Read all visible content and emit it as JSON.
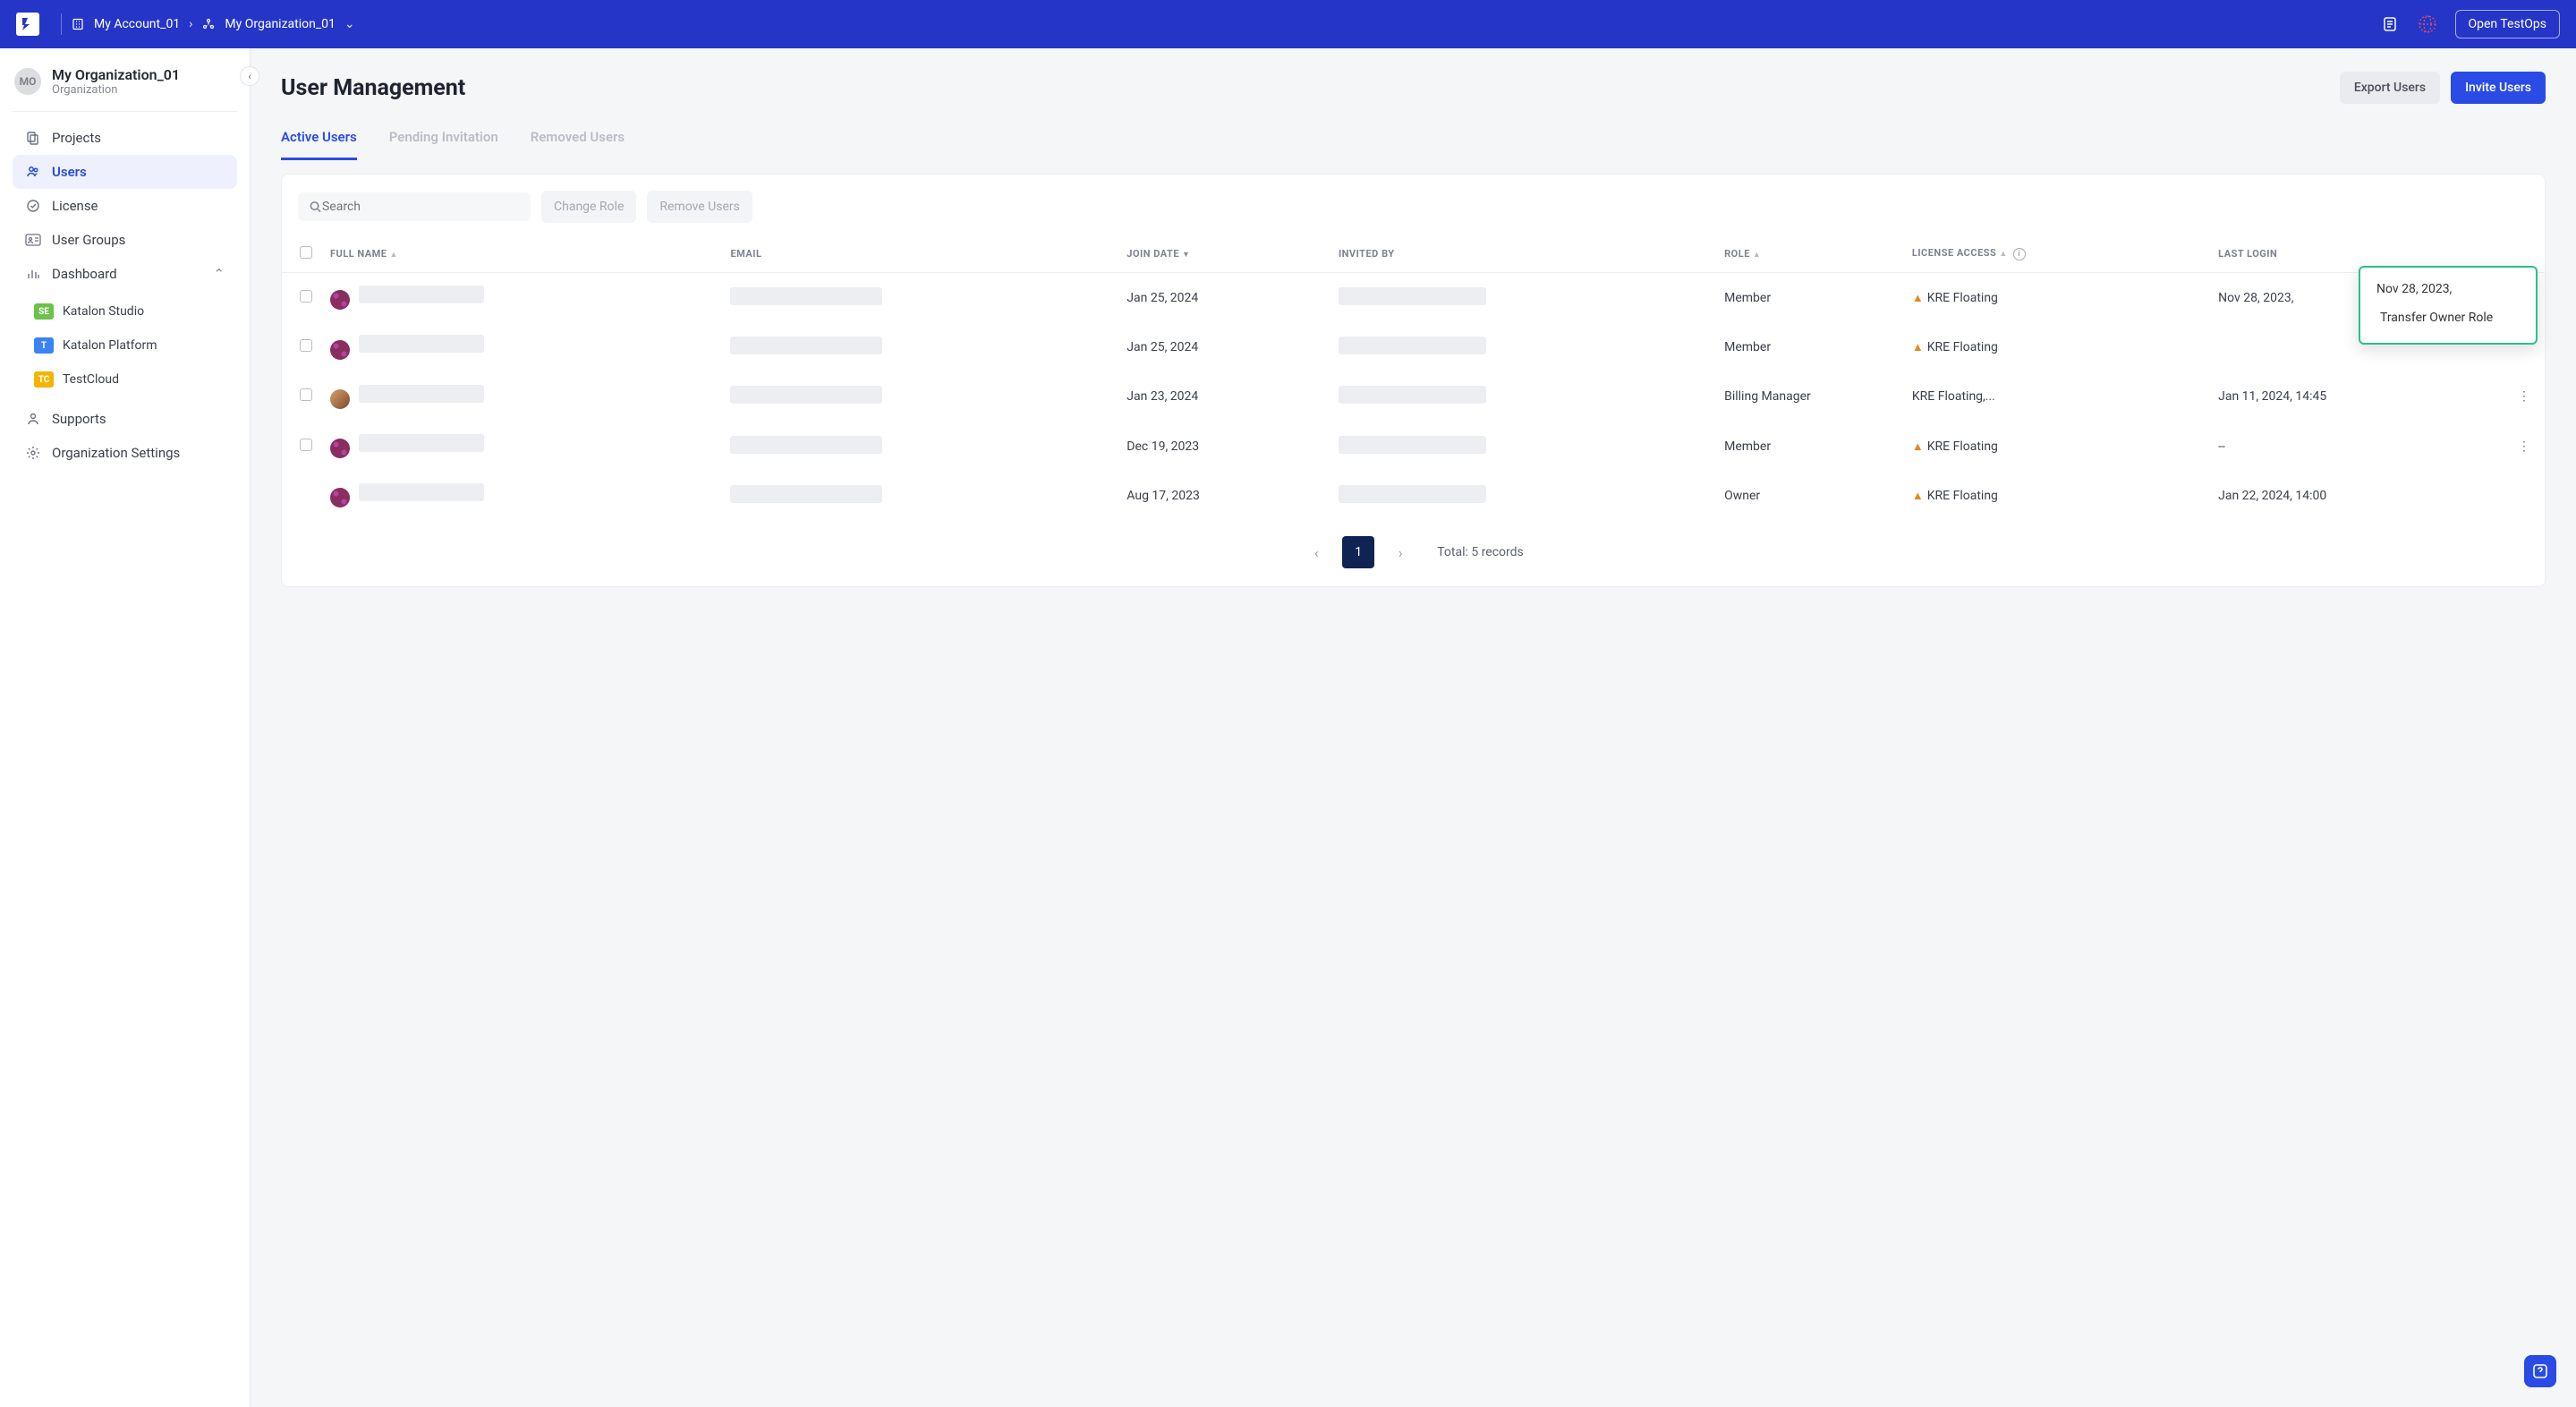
{
  "header": {
    "account_label": "My Account_01",
    "org_label": "My Organization_01",
    "open_testops": "Open TestOps"
  },
  "sidebar": {
    "org_initials": "MO",
    "org_name": "My Organization_01",
    "org_type": "Organization",
    "items": [
      {
        "label": "Projects",
        "icon": "projects-icon"
      },
      {
        "label": "Users",
        "icon": "users-icon",
        "active": true
      },
      {
        "label": "License",
        "icon": "license-icon"
      },
      {
        "label": "User Groups",
        "icon": "user-groups-icon"
      },
      {
        "label": "Dashboard",
        "icon": "dashboard-icon",
        "expandable": true
      }
    ],
    "dashboard_children": [
      {
        "label": "Katalon Studio",
        "style": "ks"
      },
      {
        "label": "Katalon Platform",
        "style": "kp"
      },
      {
        "label": "TestCloud",
        "style": "tc"
      }
    ],
    "footer_items": [
      {
        "label": "Supports",
        "icon": "support-icon"
      },
      {
        "label": "Organization Settings",
        "icon": "settings-icon"
      }
    ]
  },
  "page": {
    "title": "User Management",
    "export_btn": "Export Users",
    "invite_btn": "Invite Users"
  },
  "tabs": [
    {
      "label": "Active Users",
      "active": true
    },
    {
      "label": "Pending Invitation"
    },
    {
      "label": "Removed Users"
    }
  ],
  "toolbar": {
    "search_placeholder": "Search",
    "change_role": "Change Role",
    "remove_users": "Remove Users"
  },
  "columns": {
    "full_name": "FULL NAME",
    "email": "EMAIL",
    "join_date": "JOIN DATE",
    "invited_by": "INVITED BY",
    "role": "ROLE",
    "license_access": "LICENSE ACCESS",
    "last_login": "LAST LOGIN"
  },
  "rows": [
    {
      "join_date": "Jan 25, 2024",
      "role": "Member",
      "license": "KRE Floating",
      "warn": true,
      "last_login": "Nov 28, 2023,",
      "avatar": "pattern",
      "has_menu": true
    },
    {
      "join_date": "Jan 25, 2024",
      "role": "Member",
      "license": "KRE Floating",
      "warn": true,
      "last_login": "",
      "avatar": "pattern",
      "has_menu": false
    },
    {
      "join_date": "Jan 23, 2024",
      "role": "Billing Manager",
      "license": "KRE Floating,...",
      "warn": false,
      "last_login": "Jan 11, 2024, 14:45",
      "avatar": "photo",
      "has_menu": true
    },
    {
      "join_date": "Dec 19, 2023",
      "role": "Member",
      "license": "KRE Floating",
      "warn": true,
      "last_login": "--",
      "avatar": "pattern",
      "has_menu": true
    },
    {
      "join_date": "Aug 17, 2023",
      "role": "Owner",
      "license": "KRE Floating",
      "warn": true,
      "last_login": "Jan 22, 2024, 14:00",
      "avatar": "pattern",
      "has_menu": false,
      "no_checkbox": true
    }
  ],
  "dropdown": {
    "item": "Transfer Owner Role"
  },
  "pagination": {
    "current": "1",
    "total_label": "Total: 5 records"
  }
}
